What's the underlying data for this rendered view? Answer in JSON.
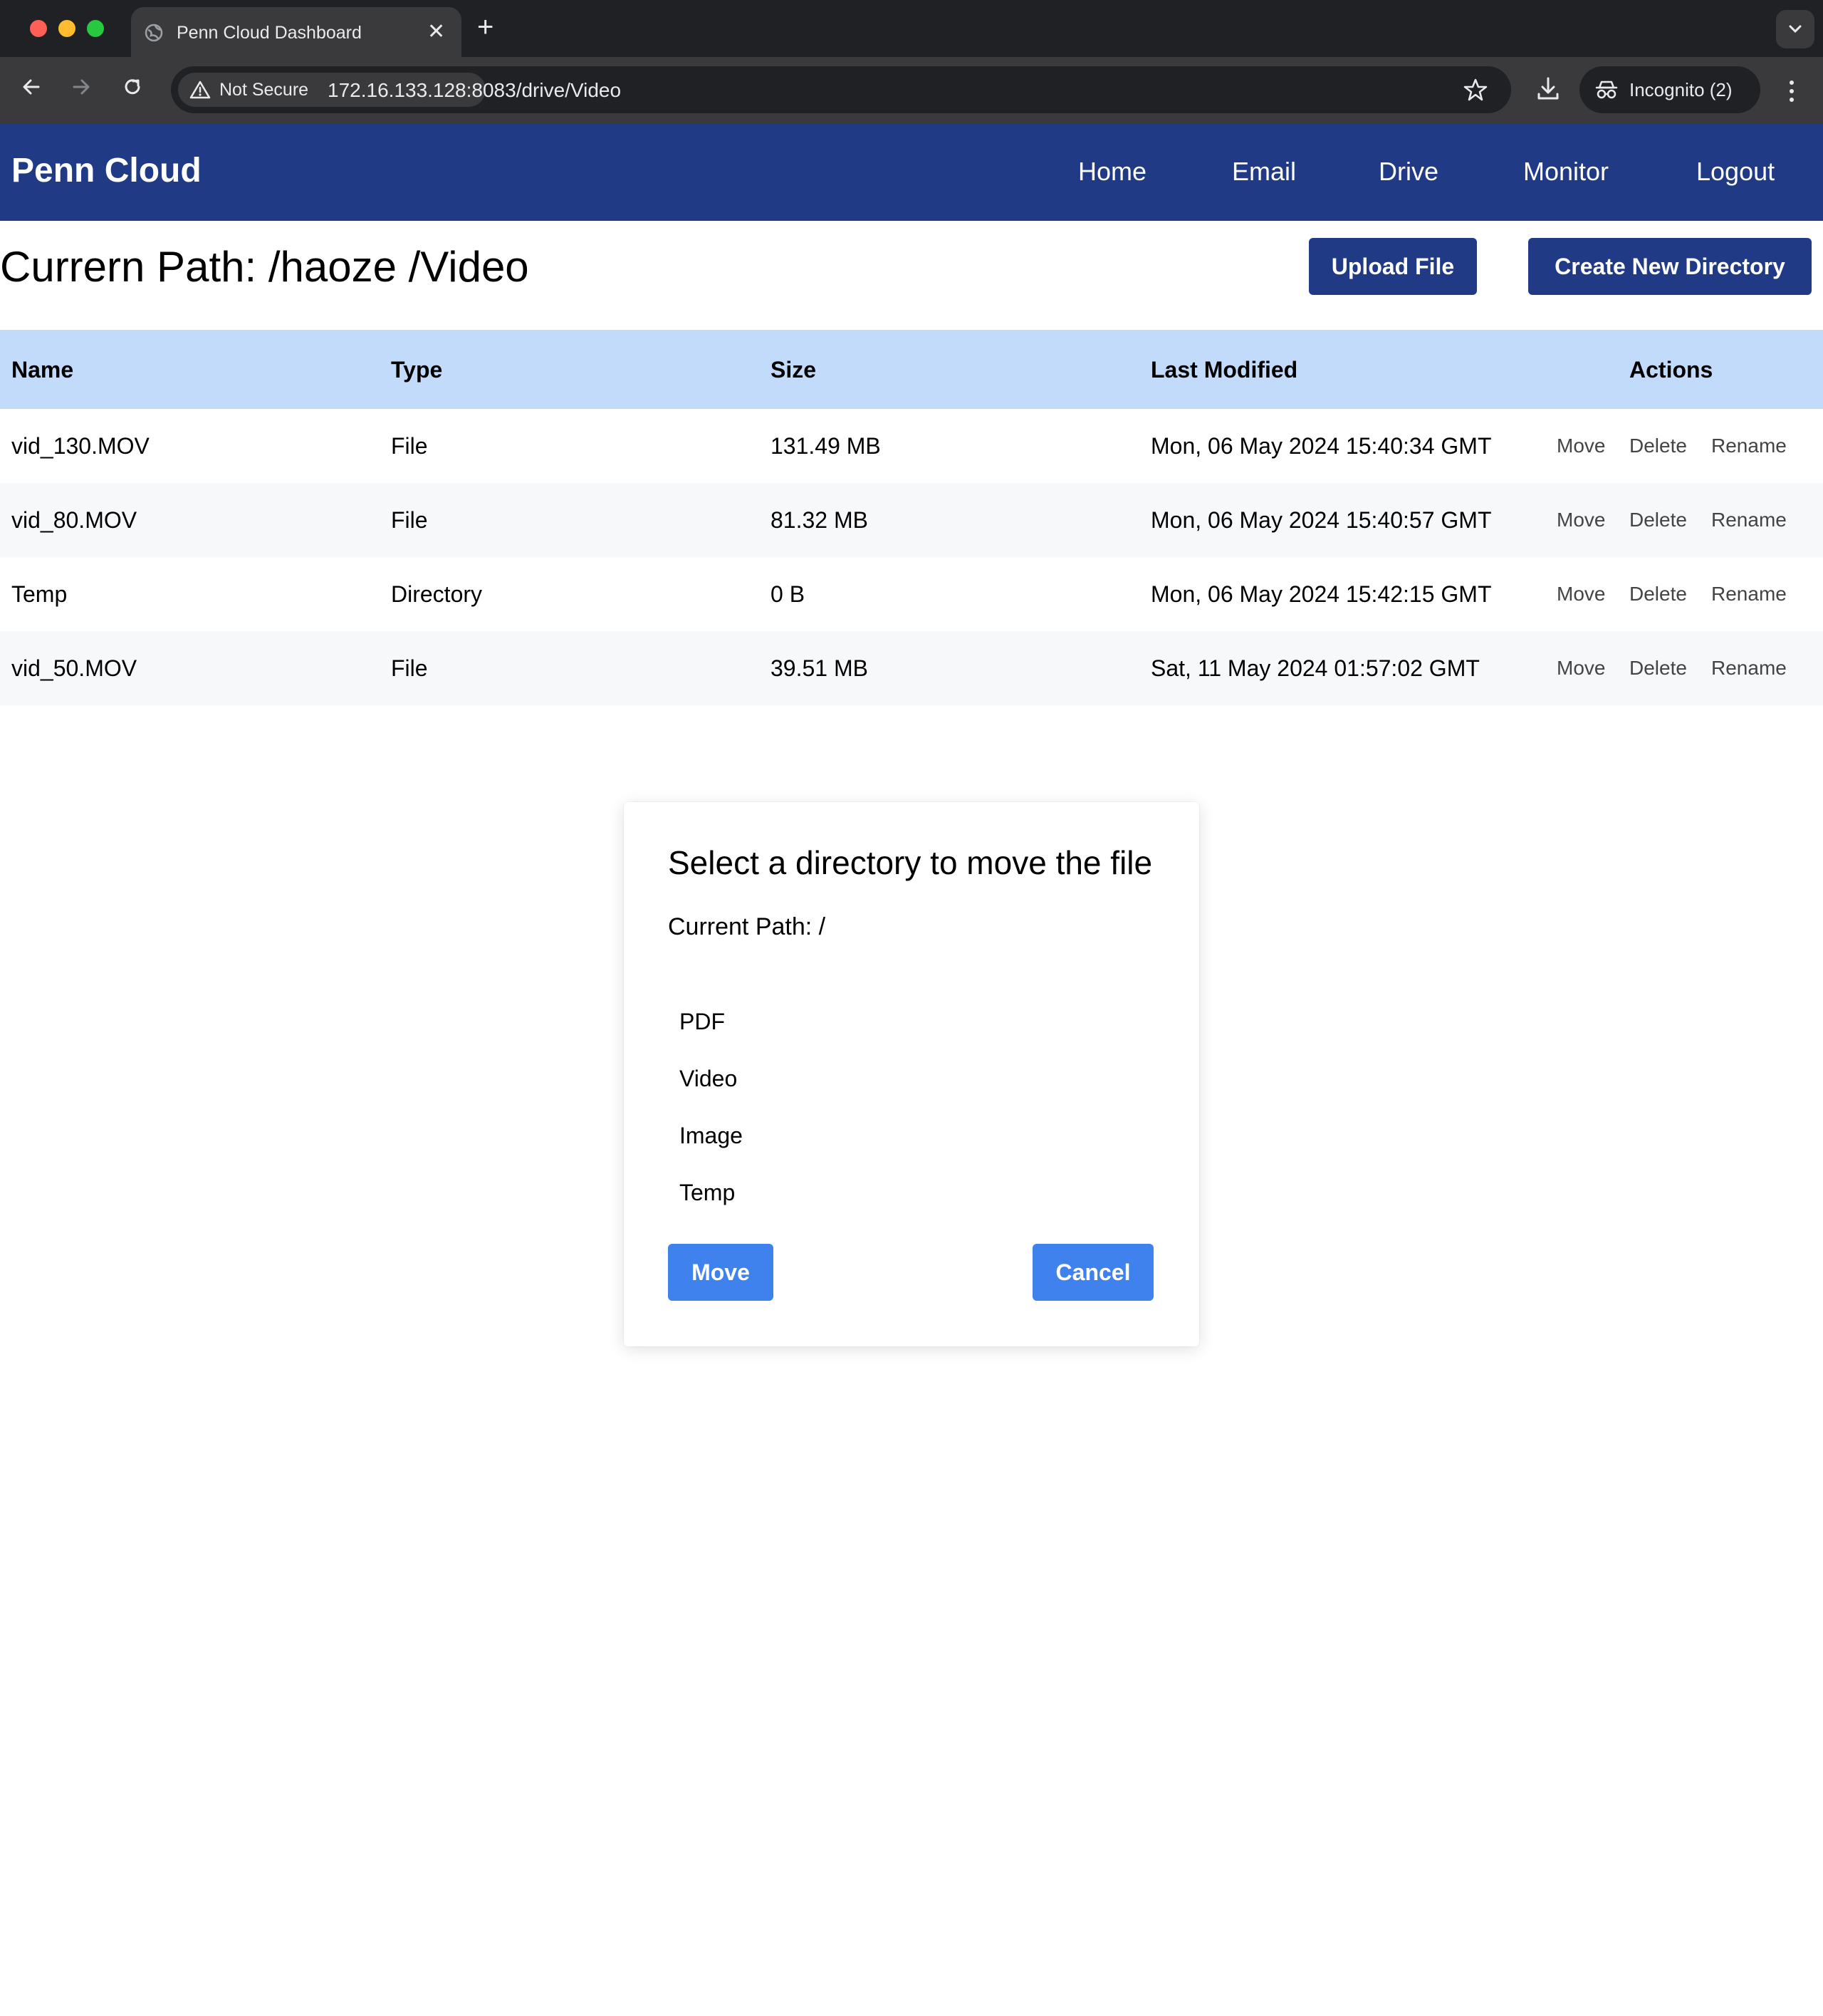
{
  "browser": {
    "tab_title": "Penn Cloud Dashboard",
    "security_label": "Not Secure",
    "url": "172.16.133.128:8083/drive/Video",
    "profile_label": "Incognito (2)"
  },
  "header": {
    "brand": "Penn Cloud",
    "nav": [
      "Home",
      "Email",
      "Drive",
      "Monitor",
      "Logout"
    ]
  },
  "path": {
    "title": "Currern Path: /haoze /Video",
    "upload_label": "Upload File",
    "create_dir_label": "Create New Directory"
  },
  "table": {
    "columns": [
      "Name",
      "Type",
      "Size",
      "Last Modified",
      "Actions"
    ],
    "rows": [
      {
        "name": "vid_130.MOV",
        "type": "File",
        "size": "131.49 MB",
        "modified": "Mon, 06 May 2024 15:40:34 GMT"
      },
      {
        "name": "vid_80.MOV",
        "type": "File",
        "size": "81.32 MB",
        "modified": "Mon, 06 May 2024 15:40:57 GMT"
      },
      {
        "name": "Temp",
        "type": "Directory",
        "size": "0 B",
        "modified": "Mon, 06 May 2024 15:42:15 GMT"
      },
      {
        "name": "vid_50.MOV",
        "type": "File",
        "size": "39.51 MB",
        "modified": "Sat, 11 May 2024 01:57:02 GMT"
      }
    ],
    "actions": [
      "Move",
      "Delete",
      "Rename"
    ]
  },
  "modal": {
    "title": "Select a directory to move the file",
    "current_path": "Current Path: /",
    "directories": [
      "PDF",
      "Video",
      "Image",
      "Temp"
    ],
    "move_label": "Move",
    "cancel_label": "Cancel"
  },
  "colors": {
    "header_bg": "#203a86",
    "table_header_bg": "#c3dbfa",
    "modal_button": "#3f82ee"
  }
}
